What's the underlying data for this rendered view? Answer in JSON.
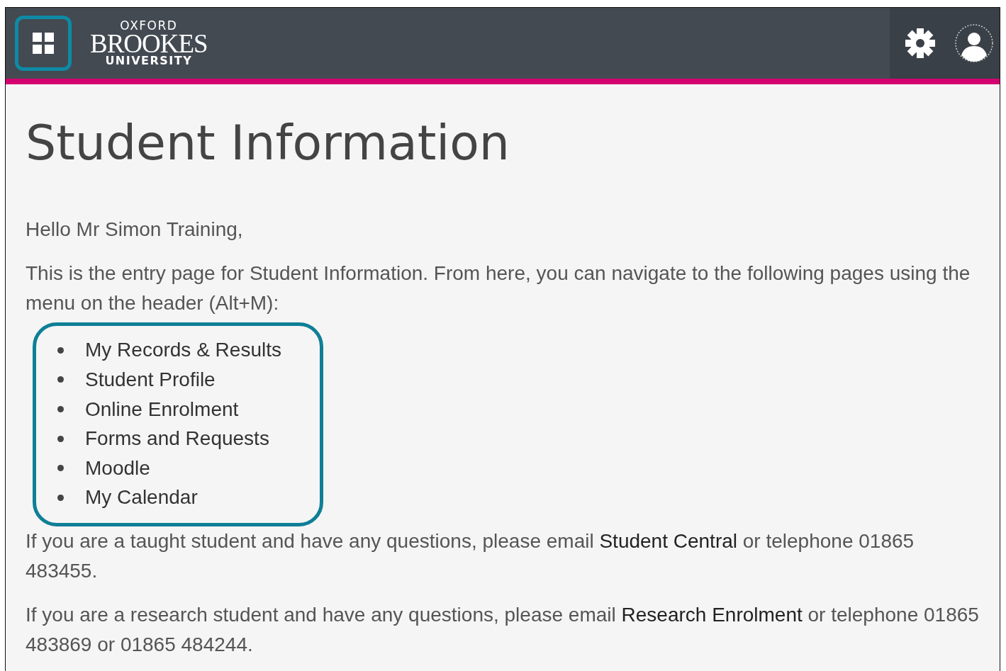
{
  "header": {
    "apps_button": {
      "highlighted": true
    },
    "logo": {
      "top": "OXFORD",
      "middle": "BROOKES",
      "bottom": "UNIVERSITY"
    }
  },
  "title": "Student Information",
  "greeting": "Hello Mr Simon Training,",
  "intro": "This is the entry page for Student Information. From here, you can navigate to the following pages using the menu on the header (Alt+M):",
  "menu": {
    "highlighted": true,
    "items": [
      "My Records & Results",
      "Student Profile",
      "Online Enrolment",
      "Forms and Requests",
      "Moodle",
      "My Calendar"
    ]
  },
  "paragraphs": [
    {
      "parts": [
        {
          "kind": "text",
          "text": "If you are a taught student and have any questions, please email "
        },
        {
          "kind": "link",
          "text": "Student Central"
        },
        {
          "kind": "text",
          "text": " or telephone 01865 483455."
        }
      ]
    },
    {
      "parts": [
        {
          "kind": "text",
          "text": "If you are a research student and have any questions, please email "
        },
        {
          "kind": "link",
          "text": "Research Enrolment"
        },
        {
          "kind": "text",
          "text": " or telephone 01865 483869 or 01865 484244."
        }
      ]
    }
  ]
}
